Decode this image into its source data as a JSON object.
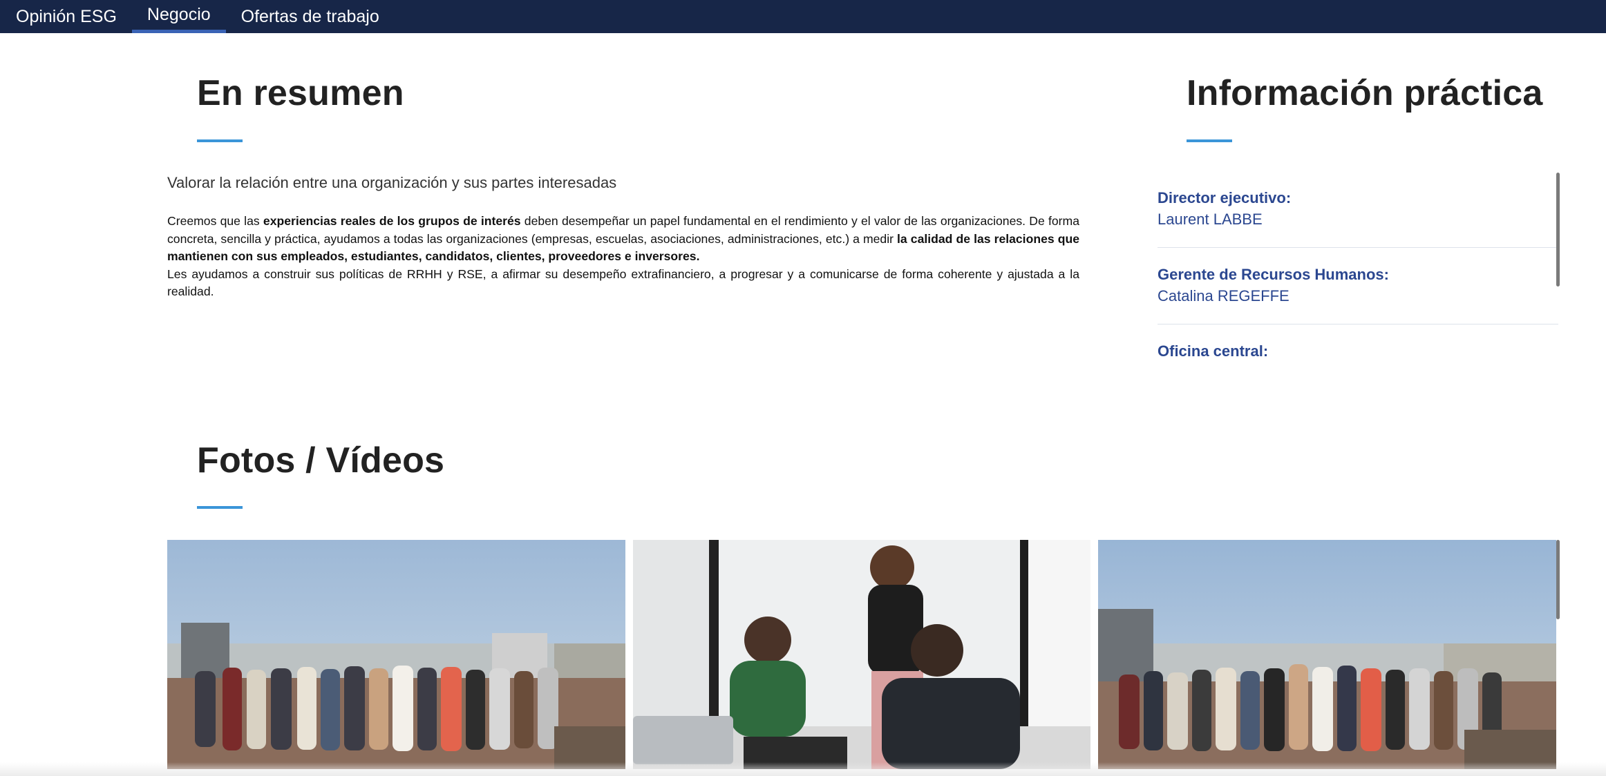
{
  "nav": {
    "tabs": [
      {
        "label": "Opinión ESG"
      },
      {
        "label": "Negocio"
      },
      {
        "label": "Ofertas de trabajo"
      }
    ],
    "active": "Negocio"
  },
  "summary": {
    "title": "En resumen",
    "lead": "Valorar la relación entre una organización y sus partes interesadas",
    "p1_a": "Creemos que las ",
    "p1_b": "experiencias reales de los grupos de interés",
    "p1_c": " deben desempeñar un papel fundamental en el rendimiento y el valor de las organizaciones. De forma concreta, sencilla y práctica, ayudamos a todas las organizaciones (empresas, escuelas, asociaciones, administraciones, etc.) a medir ",
    "p1_d": "la calidad de las relaciones que mantienen con sus empleados, estudiantes, candidatos, clientes, proveedores e inversores.",
    "p2": "Les ayudamos a construir sus políticas de RRHH y RSE, a afirmar su desempeño extrafinanciero, a progresar y a comunicarse de forma coherente y ajustada a la realidad."
  },
  "practical": {
    "title": "Información práctica",
    "items": [
      {
        "label": "Director ejecutivo:",
        "value": "Laurent LABBE"
      },
      {
        "label": "Gerente de Recursos Humanos:",
        "value": "Catalina REGEFFE"
      },
      {
        "label": "Oficina central:",
        "value": ""
      }
    ]
  },
  "media": {
    "title": "Fotos / Vídeos"
  },
  "colors": {
    "nav_bg": "#172648",
    "nav_active": "#3a63b5",
    "accent": "#3b95d8",
    "info_text": "#2b4790"
  }
}
